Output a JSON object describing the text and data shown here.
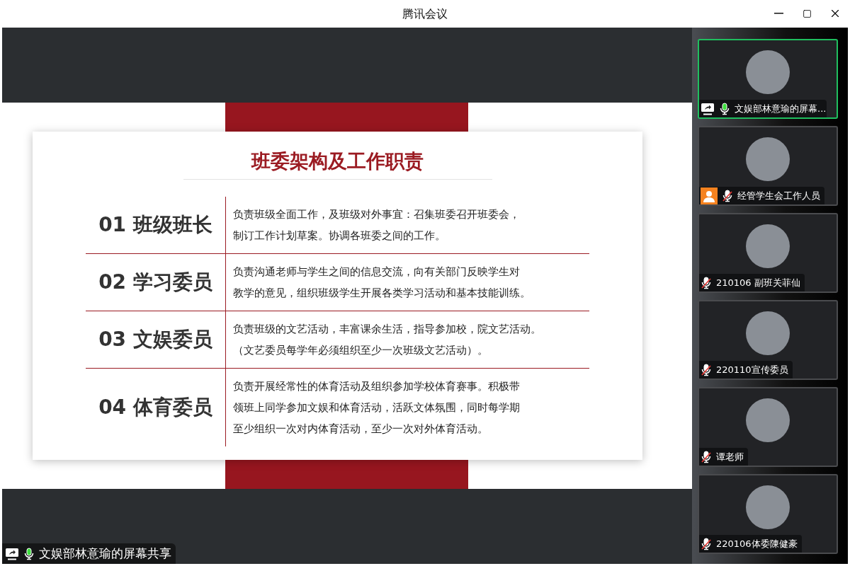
{
  "window": {
    "title": "腾讯会议"
  },
  "slide": {
    "title": "班委架构及工作职责",
    "rows": [
      {
        "label": "01 班级班长",
        "lines": [
          "负责班级全面工作，及班级对外事宜：召集班委召开班委会，",
          "制订工作计划草案。协调各班委之间的工作。"
        ]
      },
      {
        "label": "02 学习委员",
        "lines": [
          "负责沟通老师与学生之间的信息交流，向有关部门反映学生对",
          "教学的意见，组织班级学生开展各类学习活动和基本技能训练。"
        ]
      },
      {
        "label": "03 文娱委员",
        "lines": [
          "负责班级的文艺活动，丰富课余生活，指导参加校，院文艺活动。",
          "（文艺委员每学年必须组织至少一次班级文艺活动）。"
        ]
      },
      {
        "label": "04 体育委员",
        "lines": [
          "负责开展经常性的体育活动及组织参加学校体育赛事。积极带",
          "领班上同学参加文娱和体育活动，活跃文体氛围，同时每学期",
          "至少组织一次对内体育活动，至少一次对外体育活动。"
        ]
      }
    ]
  },
  "share_label": {
    "text": "文娱部林意瑜的屏幕共享",
    "muted": false
  },
  "participants": [
    {
      "name": "文娱部林意瑜的屏幕...",
      "kind": "screen_share",
      "muted": false,
      "selected": true
    },
    {
      "name": "经管学生会工作人员",
      "kind": "guest",
      "muted": true,
      "selected": false
    },
    {
      "name": "210106 副班关菲仙",
      "kind": "member",
      "muted": true,
      "selected": false
    },
    {
      "name": "220110宣传委员",
      "kind": "member",
      "muted": true,
      "selected": false
    },
    {
      "name": "谭老师",
      "kind": "member",
      "muted": true,
      "selected": false
    },
    {
      "name": "220106体委陳健豪",
      "kind": "member",
      "muted": true,
      "selected": false
    }
  ]
}
